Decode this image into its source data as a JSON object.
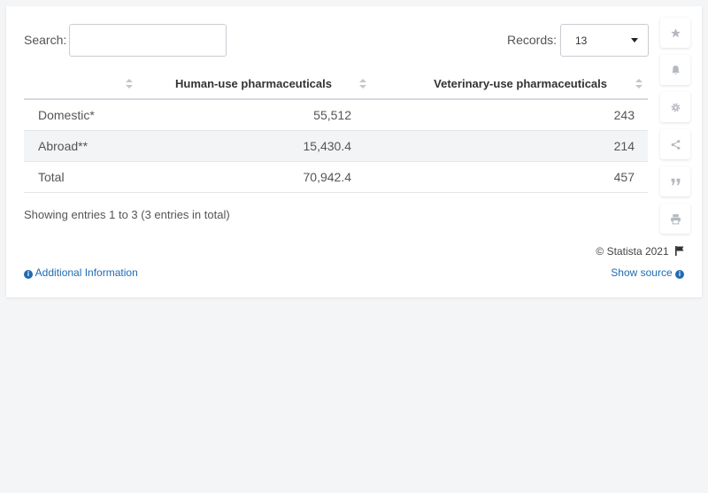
{
  "search": {
    "label": "Search:",
    "value": "",
    "placeholder": ""
  },
  "records": {
    "label": "Records:",
    "value": "13"
  },
  "chart_data": {
    "type": "table",
    "columns": [
      "",
      "Human-use pharmaceuticals",
      "Veterinary-use pharmaceuticals"
    ],
    "rows": [
      {
        "label": "Domestic*",
        "human": "55,512",
        "veterinary": "243"
      },
      {
        "label": "Abroad**",
        "human": "15,430.4",
        "veterinary": "214"
      },
      {
        "label": "Total",
        "human": "70,942.4",
        "veterinary": "457"
      }
    ]
  },
  "footer": {
    "showing": "Showing entries 1 to 3 (3 entries in total)",
    "copyright": "© Statista 2021",
    "additional_info": "Additional Information",
    "show_source": "Show source"
  },
  "sidebar_icons": [
    "star-icon",
    "bell-icon",
    "gear-icon",
    "share-icon",
    "quote-icon",
    "print-icon"
  ],
  "colors": {
    "link": "#1f6bb3",
    "row_alt": "#f2f4f6",
    "icon": "#b5bac0"
  }
}
